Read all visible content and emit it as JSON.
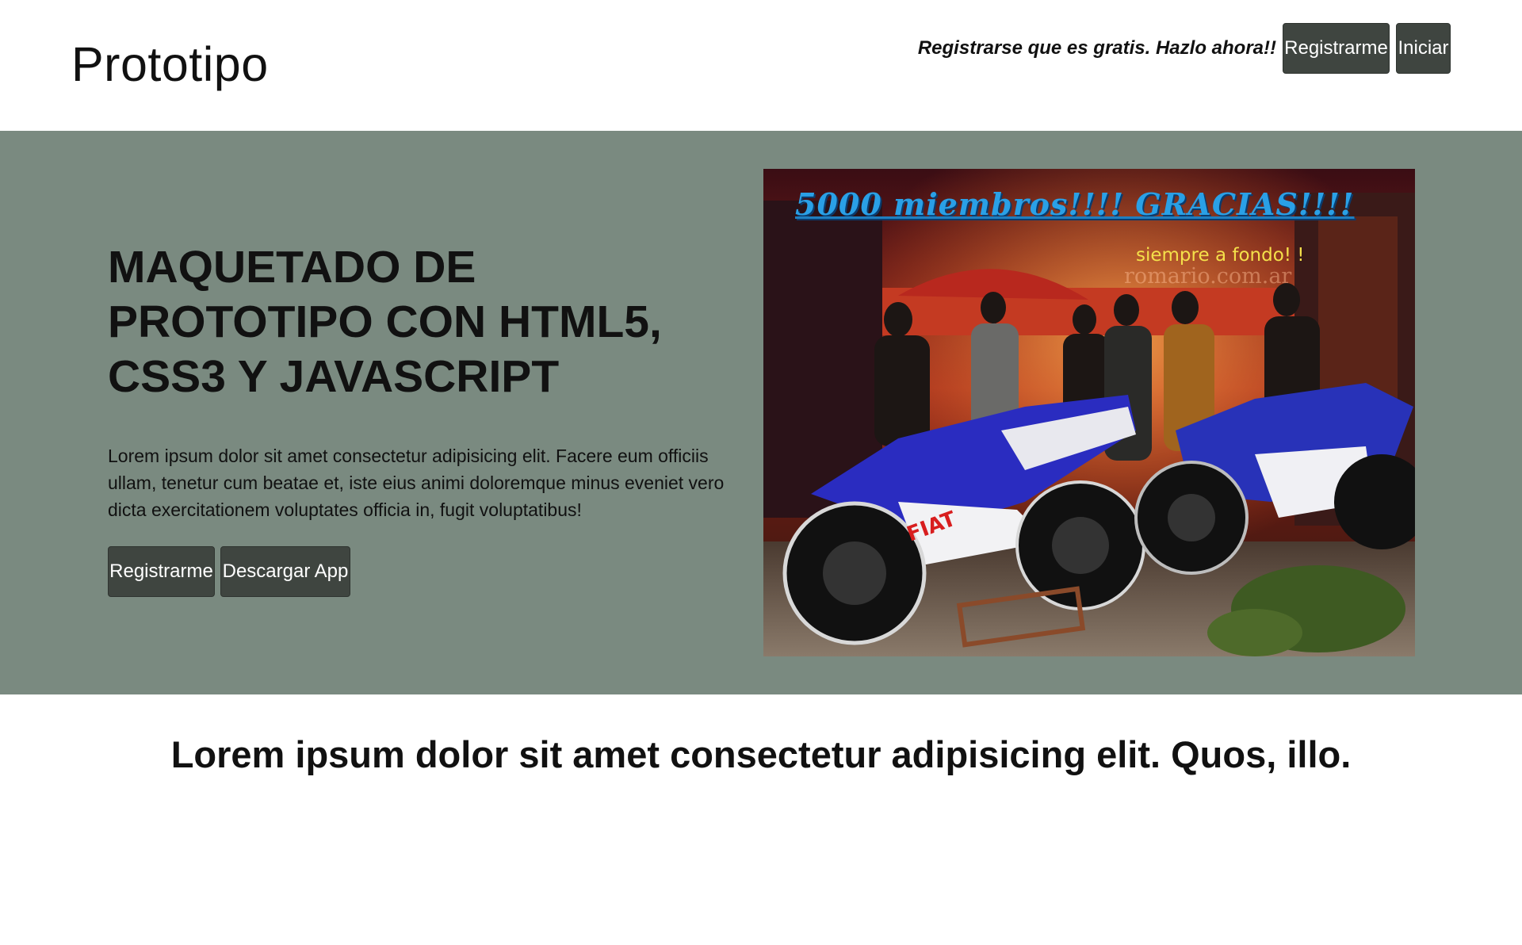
{
  "header": {
    "brand": "Prototipo",
    "promo": "Registrarse que es gratis. Hazlo ahora!!",
    "register_label": "Registrarme",
    "login_label": "Iniciar"
  },
  "hero": {
    "title": "MAQUETADO DE PROTOTIPO CON HTML5, CSS3 Y JAVASCRIPT",
    "text": "Lorem ipsum dolor sit amet consectetur adipisicing elit. Facere eum officiis ullam, tenetur cum beatae et, iste eius animi doloremque minus eveniet vero dicta exercitationem voluptates officia in, fugit voluptatibus!",
    "register_label": "Registrarme",
    "download_label": "Descargar App",
    "image": {
      "headline": "5000 miembros!!!! GRACIAS!!!!",
      "slogan": "siempre a fondo! !",
      "watermark": "romario.com.ar"
    }
  },
  "section": {
    "heading": "Lorem ipsum dolor sit amet consectetur adipisicing elit. Quos, illo."
  },
  "colors": {
    "hero_background": "#7a8a80",
    "button_background": "#3f4540",
    "button_text": "#ffffff"
  }
}
